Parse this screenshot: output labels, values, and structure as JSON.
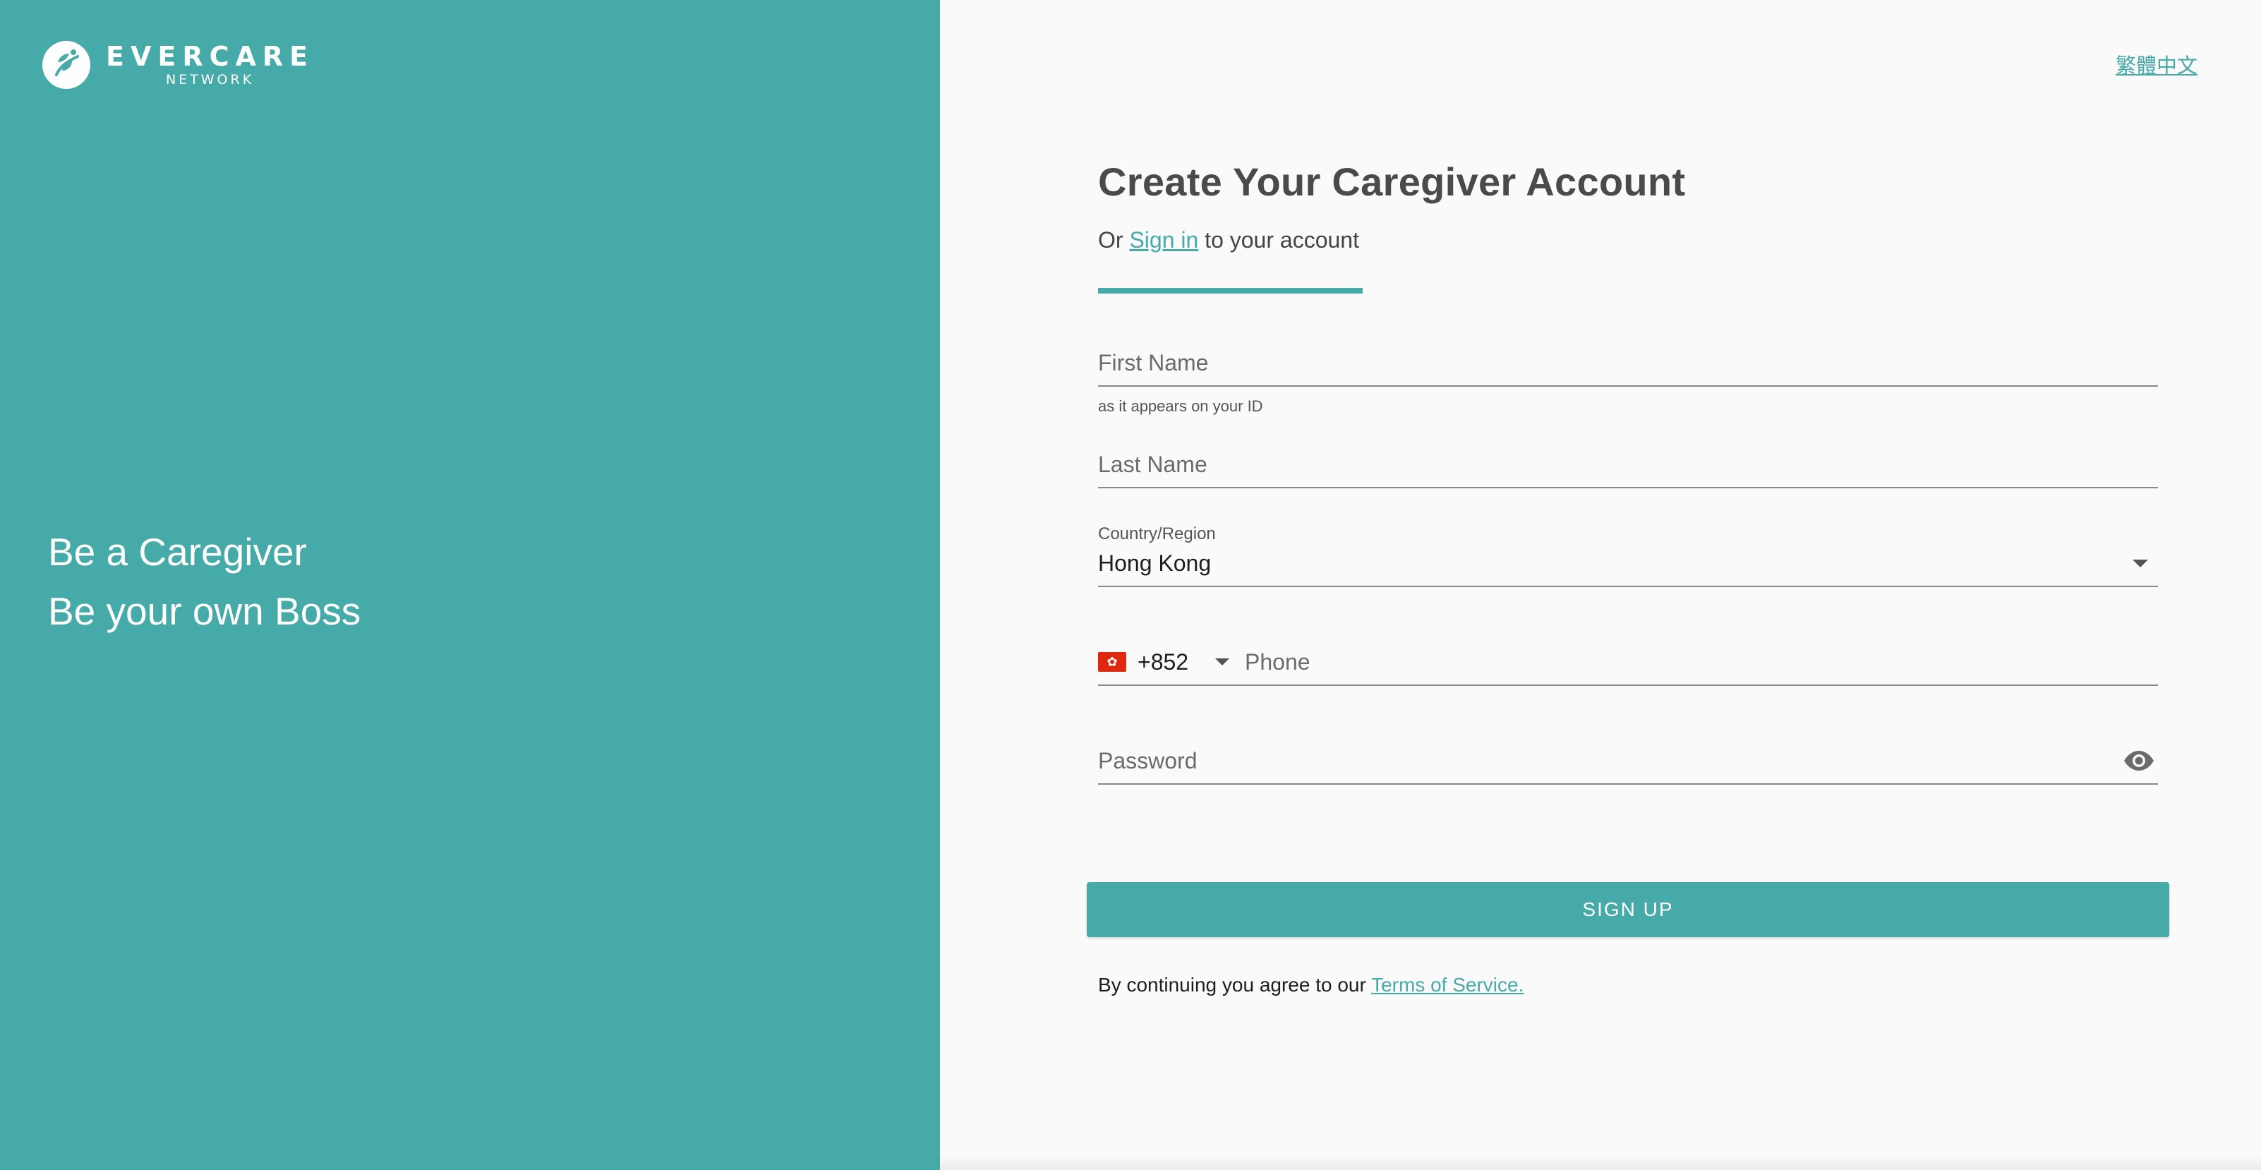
{
  "brand": {
    "name": "EVERCARE",
    "sub": "NETWORK"
  },
  "hero": {
    "line1": "Be a Caregiver",
    "line2": "Be your own Boss"
  },
  "lang_link": "繁體中文",
  "form": {
    "title": "Create Your Caregiver Account",
    "subtitle_prefix": "Or",
    "signin_link": "Sign in",
    "subtitle_suffix": "to your account",
    "first_name": {
      "placeholder": "First Name",
      "helper": "as it appears on your ID"
    },
    "last_name": {
      "placeholder": "Last Name"
    },
    "country": {
      "label": "Country/Region",
      "value": "Hong Kong"
    },
    "phone": {
      "flag_icon": "hong-kong-flag-icon",
      "dial_code": "+852",
      "placeholder": "Phone"
    },
    "password": {
      "placeholder": "Password",
      "toggle_icon": "eye-icon"
    },
    "signup_button": "SIGN UP",
    "terms_prefix": "By continuing you agree to our",
    "terms_link": "Terms of Service."
  },
  "colors": {
    "accent": "#46aaa8",
    "background": "#fafafa",
    "text": "#4a4a4a"
  }
}
